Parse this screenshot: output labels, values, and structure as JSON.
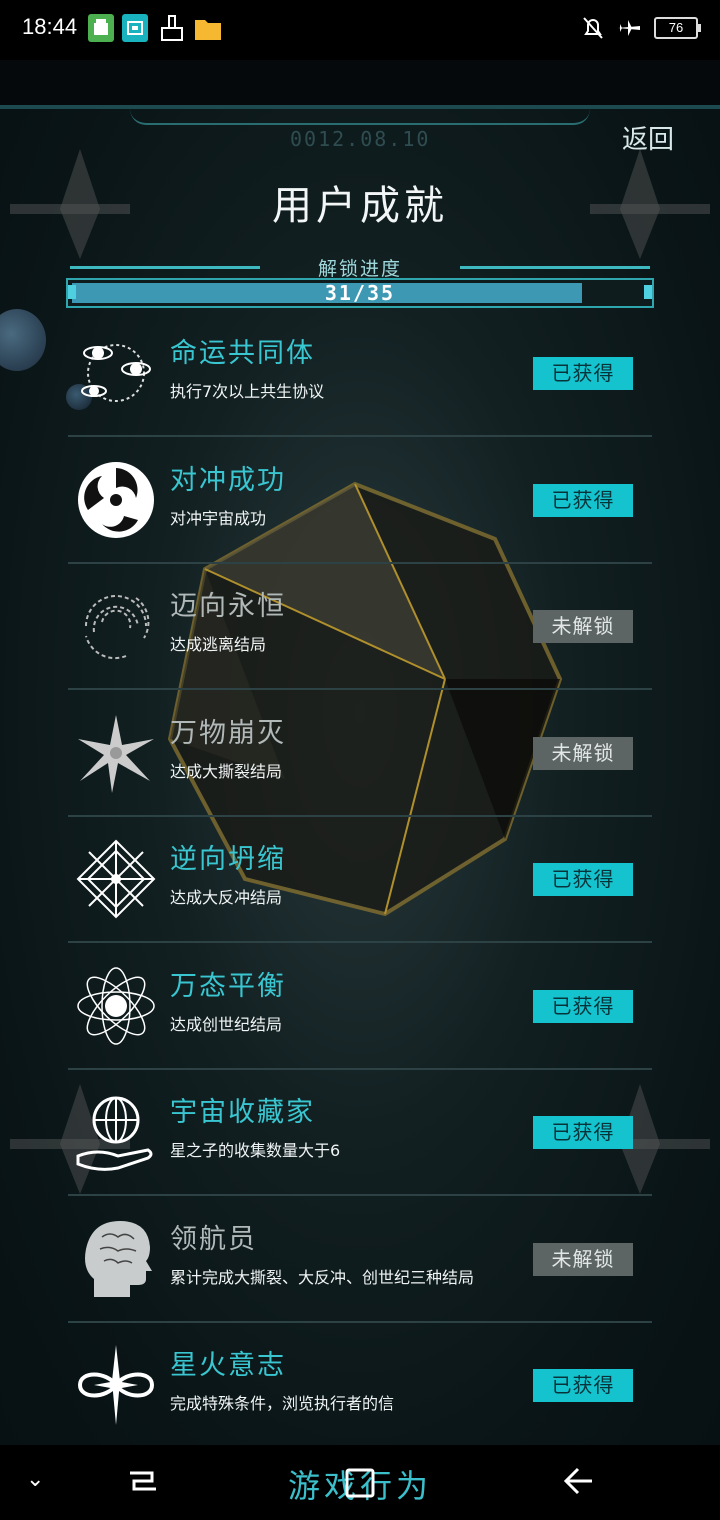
{
  "status_bar": {
    "time": "18:44",
    "battery": "76",
    "left_icons": [
      "android-icon",
      "scan-icon",
      "clean-icon",
      "folder-icon"
    ],
    "right_icons": [
      "mute-icon",
      "airplane-icon",
      "battery-icon"
    ]
  },
  "header": {
    "deco_date": "0012.08.10",
    "back_label": "返回",
    "title": "用户成就"
  },
  "progress": {
    "label": "解锁进度",
    "text": "31/35",
    "unlocked": 31,
    "total": 35
  },
  "colors": {
    "accent": "#39c6d1",
    "obtained_bg": "#14c3cd",
    "locked_bg": "#5c6564"
  },
  "achievements": [
    {
      "title": "命运共同体",
      "desc": "执行7次以上共生协议",
      "status": "已获得",
      "icon": "orbit-planets-icon"
    },
    {
      "title": "对冲成功",
      "desc": "对冲宇宙成功",
      "status": "已获得",
      "icon": "triple-swirl-icon"
    },
    {
      "title": "迈向永恒",
      "desc": "达成逃离结局",
      "status": "未解锁",
      "icon": "vortex-icon"
    },
    {
      "title": "万物崩灭",
      "desc": "达成大撕裂结局",
      "status": "未解锁",
      "icon": "burst-icon"
    },
    {
      "title": "逆向坍缩",
      "desc": "达成大反冲结局",
      "status": "已获得",
      "icon": "snowflake-mandala-icon"
    },
    {
      "title": "万态平衡",
      "desc": "达成创世纪结局",
      "status": "已获得",
      "icon": "atom-orbit-icon"
    },
    {
      "title": "宇宙收藏家",
      "desc": "星之子的收集数量大于6",
      "status": "已获得",
      "icon": "sphere-hand-icon"
    },
    {
      "title": "领航员",
      "desc": "累计完成大撕裂、大反冲、创世纪三种结局",
      "status": "未解锁",
      "icon": "brain-head-icon"
    },
    {
      "title": "星火意志",
      "desc": "完成特殊条件，浏览执行者的信",
      "status": "已获得",
      "icon": "infinity-star-icon"
    }
  ],
  "footer": {
    "label": "游戏行为"
  }
}
